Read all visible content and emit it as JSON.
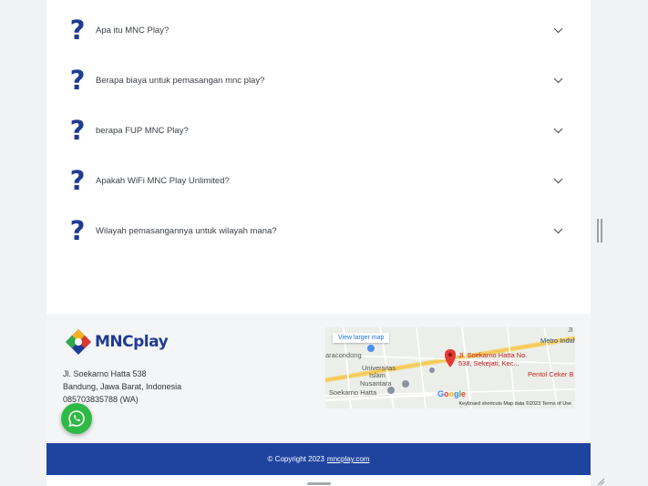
{
  "faq": {
    "items": [
      {
        "question": "Apa itu MNC Play?"
      },
      {
        "question": "Berapa biaya untuk pemasangan mnc play?"
      },
      {
        "question": "berapa FUP MNC Play?"
      },
      {
        "question": "Apakah WiFi MNC Play Unlimited?"
      },
      {
        "question": "Wilayah pemasangannya untuk wilayah mana?"
      }
    ],
    "question_mark": "?",
    "icon": "question-mark-icon",
    "chevron_icon": "chevron-down-icon"
  },
  "footer": {
    "logo_text": "MNCplay",
    "address": {
      "line1": "Jl. Soekarno Hatta 538",
      "line2": "Bandung, Jawa Barat, Indonesia",
      "line3": "085703835788 (WA)"
    },
    "map": {
      "view_larger": "View larger map",
      "labels": {
        "metro": "Metro Indah Ma",
        "aracondong": "aracondong",
        "univ1": "Universitas",
        "univ2": "Islam",
        "univ3": "Nusantara",
        "soekarno": "Soekarno Hatta",
        "pentol": "Pentol Ceker B",
        "jl": "Jl"
      },
      "pin_address_line1": "Jl. Soekarno Hatta No.",
      "pin_address_line2": "538, Sekejati, Kec...",
      "google": "Google",
      "attribution": "Keyboard shortcuts    Map data ©2023    Terms of Use"
    }
  },
  "copyright": {
    "text": "© Copyright 2023",
    "link": "mncplay.com"
  },
  "whatsapp": {
    "icon": "whatsapp-icon"
  },
  "colors": {
    "brand_blue": "#1f3c93",
    "footer_bar": "#1f44a0",
    "whatsapp_green": "#2fb945"
  }
}
